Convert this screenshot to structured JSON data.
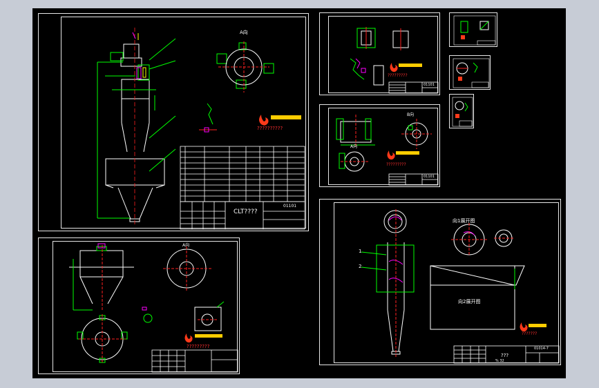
{
  "sheets": {
    "main": {
      "title": "CLT????",
      "code": "01101",
      "view_label": "A向",
      "caption": "??????????"
    },
    "hopper": {
      "view_label": "A向",
      "caption": "?????????"
    },
    "upper_mid": {
      "caption": "?????????",
      "code": "01101"
    },
    "mid": {
      "view_label": "A向",
      "view_label2": "B向",
      "caption": "?????????",
      "code": "01101"
    },
    "right": {
      "label_1": "1",
      "label_2": "2",
      "label_a": "向1展开图",
      "label_b": "向2展开图",
      "title": "???",
      "code": "01014-7",
      "caption": "???????",
      "sub": "% 32"
    }
  },
  "colors": {
    "bg": "#000000",
    "line": "#ffffff",
    "green": "#00ff00",
    "red": "#ff2020",
    "magenta": "#ff00ff",
    "yellow": "#ffff00",
    "cyan": "#00ffff",
    "window": "#c7ccd6"
  }
}
